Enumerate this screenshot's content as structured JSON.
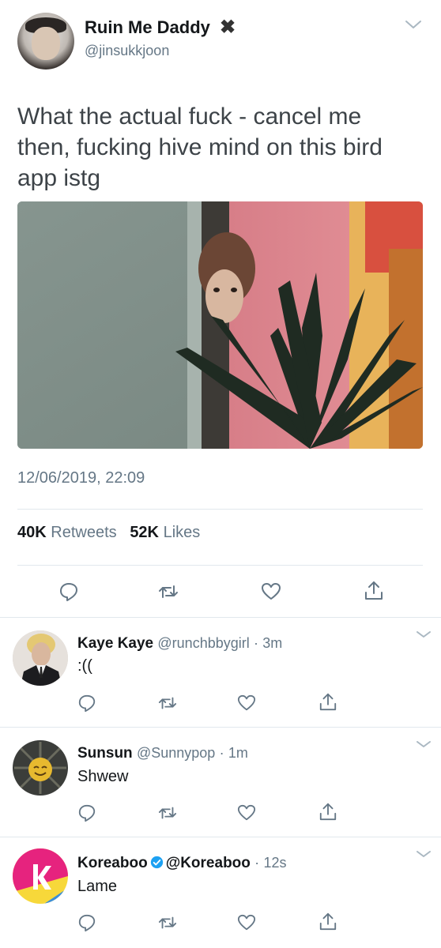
{
  "main_tweet": {
    "display_name": "Ruin Me Daddy",
    "name_mark": "✖",
    "handle": "@jinsukkjoon",
    "text": "What the actual fuck - cancel me then, fucking hive mind on this bird app istg",
    "timestamp": "12/06/2019, 22:09",
    "retweets_count": "40K",
    "retweets_label": "Retweets",
    "likes_count": "52K",
    "likes_label": "Likes",
    "actions": [
      "reply-icon",
      "retweet-icon",
      "like-icon",
      "share-icon"
    ]
  },
  "replies": [
    {
      "display_name": "Kaye Kaye",
      "handle": "@runchbbygirl",
      "sep": "·",
      "time": "3m",
      "text": ":((",
      "verified": false
    },
    {
      "display_name": "Sunsun",
      "handle": "@Sunnypop",
      "sep": "·",
      "time": "1m",
      "text": "Shwew",
      "verified": false
    },
    {
      "display_name": "Koreaboo",
      "handle": "@Koreaboo",
      "sep": "·",
      "time": "12s",
      "text": "Lame",
      "verified": true
    }
  ],
  "colors": {
    "icon_gray": "#657786",
    "verified_blue": "#1da1f2",
    "text_dark": "#14171a"
  }
}
